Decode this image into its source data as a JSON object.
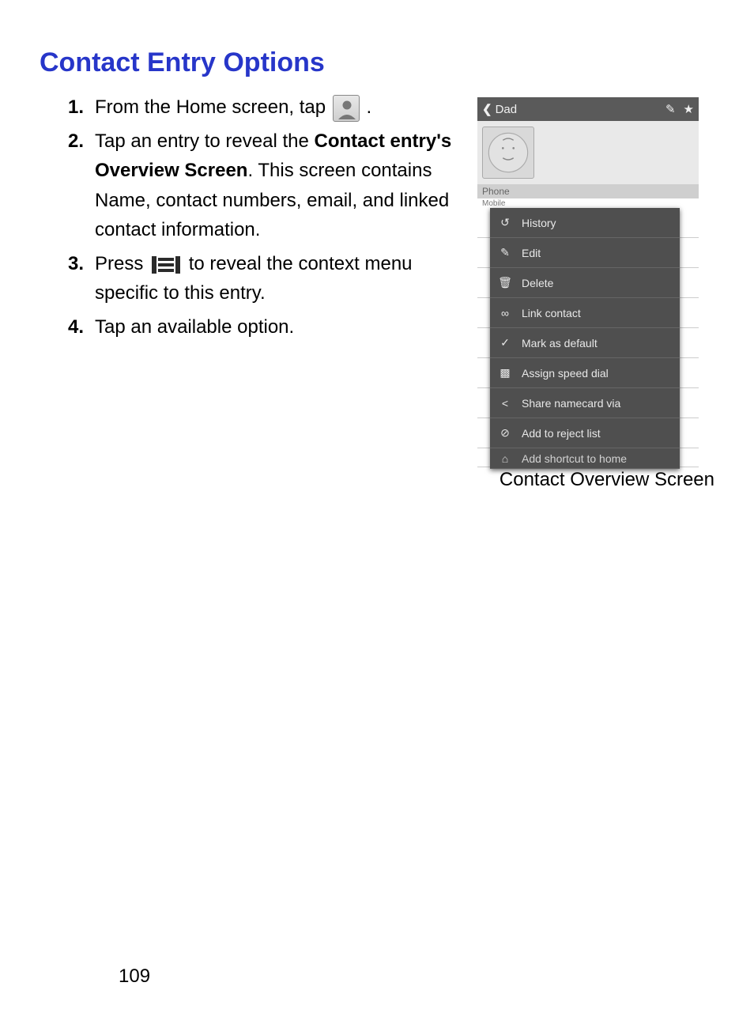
{
  "heading": "Contact Entry Options",
  "steps": [
    {
      "num": "1.",
      "pre": "From the Home screen, tap ",
      "post": "."
    },
    {
      "num": "2.",
      "pre": "Tap an entry to reveal the ",
      "bold": "Contact entry's Overview Screen",
      "post": ". This screen contains Name, contact numbers, email, and linked contact information."
    },
    {
      "num": "3.",
      "pre": "Press ",
      "post": " to reveal the context menu specific to this entry."
    },
    {
      "num": "4.",
      "pre": "Tap an available option."
    }
  ],
  "phone": {
    "title": "Dad",
    "section": "Phone",
    "tiny": "Mobile",
    "menu": [
      {
        "icon": "history-icon",
        "label": "History"
      },
      {
        "icon": "pencil-icon",
        "label": "Edit"
      },
      {
        "icon": "trash-icon",
        "label": "Delete"
      },
      {
        "icon": "link-icon",
        "label": "Link contact"
      },
      {
        "icon": "check-icon",
        "label": "Mark as default"
      },
      {
        "icon": "dial-icon",
        "label": "Assign speed dial"
      },
      {
        "icon": "share-icon",
        "label": "Share namecard via"
      },
      {
        "icon": "block-icon",
        "label": "Add to reject list"
      },
      {
        "icon": "home-icon",
        "label": "Add shortcut to home"
      }
    ]
  },
  "caption": "Contact Overview Screen",
  "page": "109"
}
